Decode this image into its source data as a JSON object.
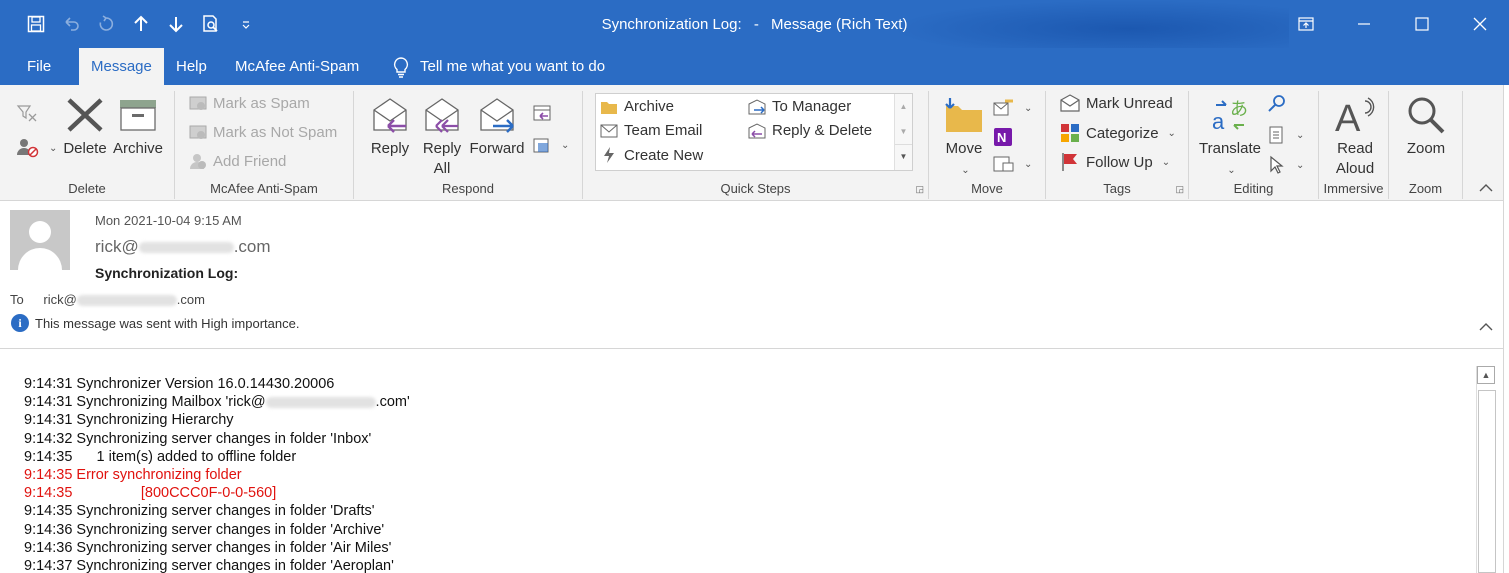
{
  "window": {
    "title_subject": "Synchronization Log:",
    "title_sep": "-",
    "title_suffix": "Message (Rich Text)"
  },
  "qat": {
    "save": "save-icon",
    "undo": "undo-icon",
    "redo": "redo-icon",
    "up": "arrow-up-icon",
    "down": "arrow-down-icon",
    "print_preview": "print-preview-icon",
    "customize": "customize-icon"
  },
  "tabs": [
    {
      "label": "File"
    },
    {
      "label": "Message"
    },
    {
      "label": "Help"
    },
    {
      "label": "McAfee Anti-Spam"
    }
  ],
  "tell_me": "Tell me what you want to do",
  "ribbon": {
    "delete": {
      "label": "Delete",
      "delete_btn": "Delete",
      "archive_btn": "Archive"
    },
    "mcafee": {
      "label": "McAfee Anti-Spam",
      "mark_spam": "Mark as Spam",
      "mark_not_spam": "Mark as Not Spam",
      "add_friend": "Add Friend"
    },
    "respond": {
      "label": "Respond",
      "reply": "Reply",
      "reply_all_1": "Reply",
      "reply_all_2": "All",
      "forward": "Forward"
    },
    "quick_steps": {
      "label": "Quick Steps",
      "archive": "Archive",
      "team_email": "Team Email",
      "create_new": "Create New",
      "to_manager": "To Manager",
      "reply_delete": "Reply & Delete"
    },
    "move": {
      "label": "Move",
      "move_btn": "Move"
    },
    "tags": {
      "label": "Tags",
      "mark_unread": "Mark Unread",
      "categorize": "Categorize",
      "follow_up": "Follow Up"
    },
    "editing": {
      "label": "Editing",
      "translate": "Translate"
    },
    "immersive": {
      "label": "Immersive",
      "read_aloud_1": "Read",
      "read_aloud_2": "Aloud"
    },
    "zoom": {
      "label": "Zoom",
      "zoom_btn": "Zoom"
    }
  },
  "message": {
    "date": "Mon 2021-10-04 9:15 AM",
    "from_prefix": "rick@",
    "from_suffix": ".com",
    "subject": "Synchronization Log:",
    "to_label": "To",
    "to_prefix": "rick@",
    "to_suffix": ".com",
    "importance": "This message was sent with High importance."
  },
  "log": [
    {
      "text": "9:14:31 Synchronizer Version 16.0.14430.20006",
      "error": false
    },
    {
      "text": "9:14:31 Synchronizing Mailbox 'rick@",
      "suffix": ".com'",
      "masked": true,
      "error": false
    },
    {
      "text": "9:14:31 Synchronizing Hierarchy",
      "error": false
    },
    {
      "text": "9:14:32 Synchronizing server changes in folder 'Inbox'",
      "error": false
    },
    {
      "text": "9:14:35      1 item(s) added to offline folder",
      "error": false
    },
    {
      "text": "9:14:35 Error synchronizing folder",
      "error": true
    },
    {
      "text": "9:14:35                 [800CCC0F-0-0-560]",
      "error": true
    },
    {
      "text": "9:14:35 Synchronizing server changes in folder 'Drafts'",
      "error": false
    },
    {
      "text": "9:14:36 Synchronizing server changes in folder 'Archive'",
      "error": false
    },
    {
      "text": "9:14:36 Synchronizing server changes in folder 'Air Miles'",
      "error": false
    },
    {
      "text": "9:14:37 Synchronizing server changes in folder 'Aeroplan'",
      "error": false
    }
  ],
  "colors": {
    "accent": "#2b6cc4",
    "error": "#e0120e",
    "ribbon_bg": "#f3f3f3"
  }
}
